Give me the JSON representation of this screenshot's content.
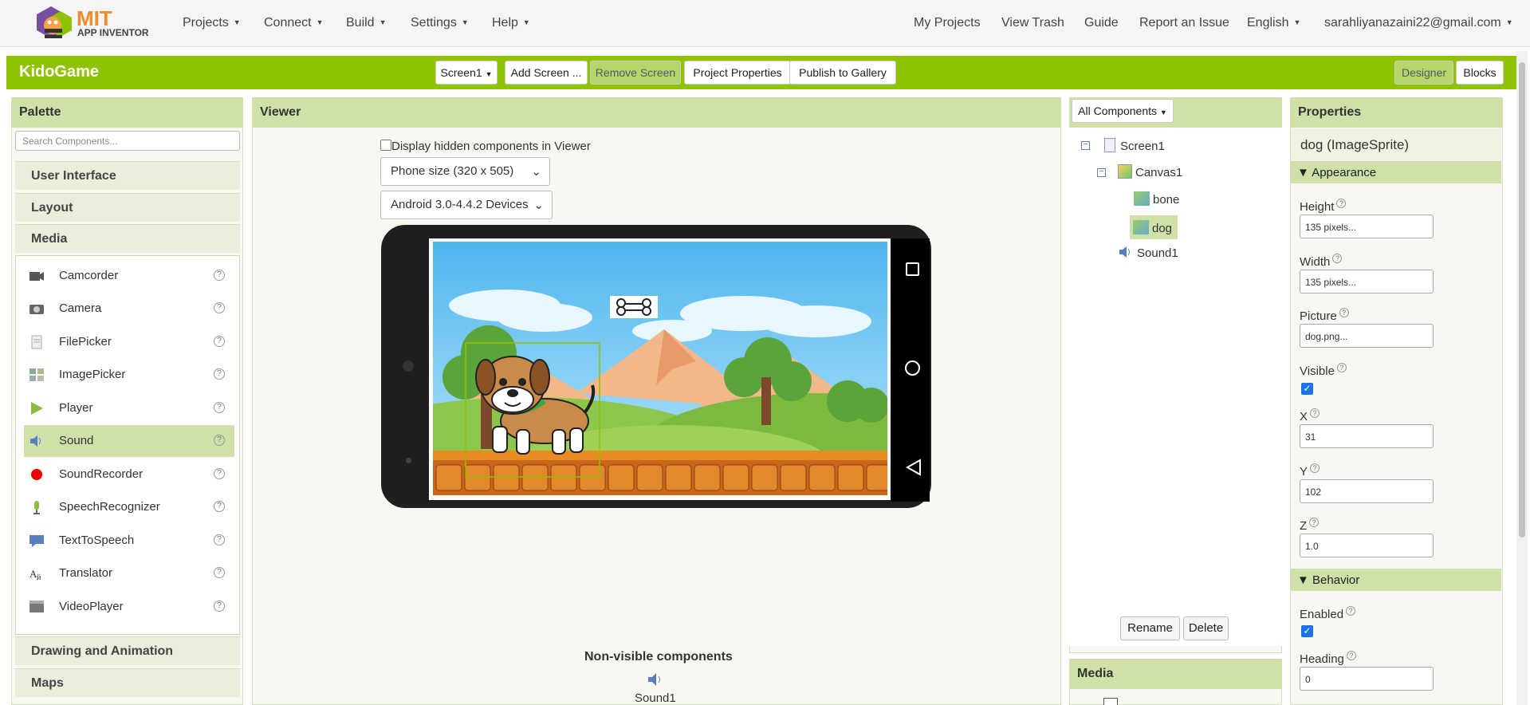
{
  "header": {
    "logo_title": "MIT",
    "logo_subtitle": "APP INVENTOR",
    "menu_left": [
      "Projects",
      "Connect",
      "Build",
      "Settings",
      "Help"
    ],
    "menu_right": [
      "My Projects",
      "View Trash",
      "Guide",
      "Report an Issue"
    ],
    "language": "English",
    "account": "sarahliyanazaini22@gmail.com"
  },
  "project": {
    "name": "KidoGame",
    "screen_select": "Screen1",
    "add_screen": "Add Screen ...",
    "remove_screen": "Remove Screen",
    "project_properties": "Project Properties",
    "publish": "Publish to Gallery",
    "designer": "Designer",
    "blocks": "Blocks"
  },
  "palette": {
    "title": "Palette",
    "search_placeholder": "Search Components...",
    "categories_top": [
      "User Interface",
      "Layout",
      "Media"
    ],
    "items": [
      {
        "label": "Camcorder",
        "icon": "camcorder-icon"
      },
      {
        "label": "Camera",
        "icon": "camera-icon"
      },
      {
        "label": "FilePicker",
        "icon": "file-icon"
      },
      {
        "label": "ImagePicker",
        "icon": "image-icon"
      },
      {
        "label": "Player",
        "icon": "play-icon"
      },
      {
        "label": "Sound",
        "icon": "speaker-icon",
        "selected": true
      },
      {
        "label": "SoundRecorder",
        "icon": "record-icon"
      },
      {
        "label": "SpeechRecognizer",
        "icon": "microphone-icon"
      },
      {
        "label": "TextToSpeech",
        "icon": "speech-bubble-icon"
      },
      {
        "label": "Translator",
        "icon": "translate-icon"
      },
      {
        "label": "VideoPlayer",
        "icon": "video-icon"
      }
    ],
    "categories_bottom": [
      "Drawing and Animation",
      "Maps"
    ],
    "help_glyph": "?"
  },
  "viewer": {
    "title": "Viewer",
    "hidden_checkbox_label": "Display hidden components in Viewer",
    "phone_size": "Phone size (320 x 505)",
    "device": "Android 3.0-4.4.2 Devices",
    "nonvisible_title": "Non-visible components",
    "nonvisible_item": "Sound1"
  },
  "components": {
    "filter": "All Components",
    "tree": [
      {
        "label": "Screen1",
        "level": 0,
        "toggle": "−",
        "icon": "screen-icon"
      },
      {
        "label": "Canvas1",
        "level": 1,
        "toggle": "−",
        "icon": "canvas-icon"
      },
      {
        "label": "bone",
        "level": 2,
        "icon": "sprite-icon"
      },
      {
        "label": "dog",
        "level": 2,
        "icon": "sprite-icon",
        "selected": true
      },
      {
        "label": "Sound1",
        "level": 1,
        "icon": "speaker-icon"
      }
    ],
    "rename": "Rename",
    "delete": "Delete",
    "media_title": "Media"
  },
  "properties": {
    "title": "Properties",
    "component": "dog (ImageSprite)",
    "appearance": "Appearance",
    "behavior": "Behavior",
    "height_label": "Height",
    "height_value": "135 pixels...",
    "width_label": "Width",
    "width_value": "135 pixels...",
    "picture_label": "Picture",
    "picture_value": "dog.png...",
    "visible_label": "Visible",
    "visible_checked": true,
    "x_label": "X",
    "x_value": "31",
    "y_label": "Y",
    "y_value": "102",
    "z_label": "Z",
    "z_value": "1.0",
    "enabled_label": "Enabled",
    "enabled_checked": true,
    "heading_label": "Heading",
    "heading_value": "0"
  },
  "colors": {
    "accent": "#8fc200",
    "panel_header": "#cfe0a8",
    "sky": "#6cc8f0"
  }
}
